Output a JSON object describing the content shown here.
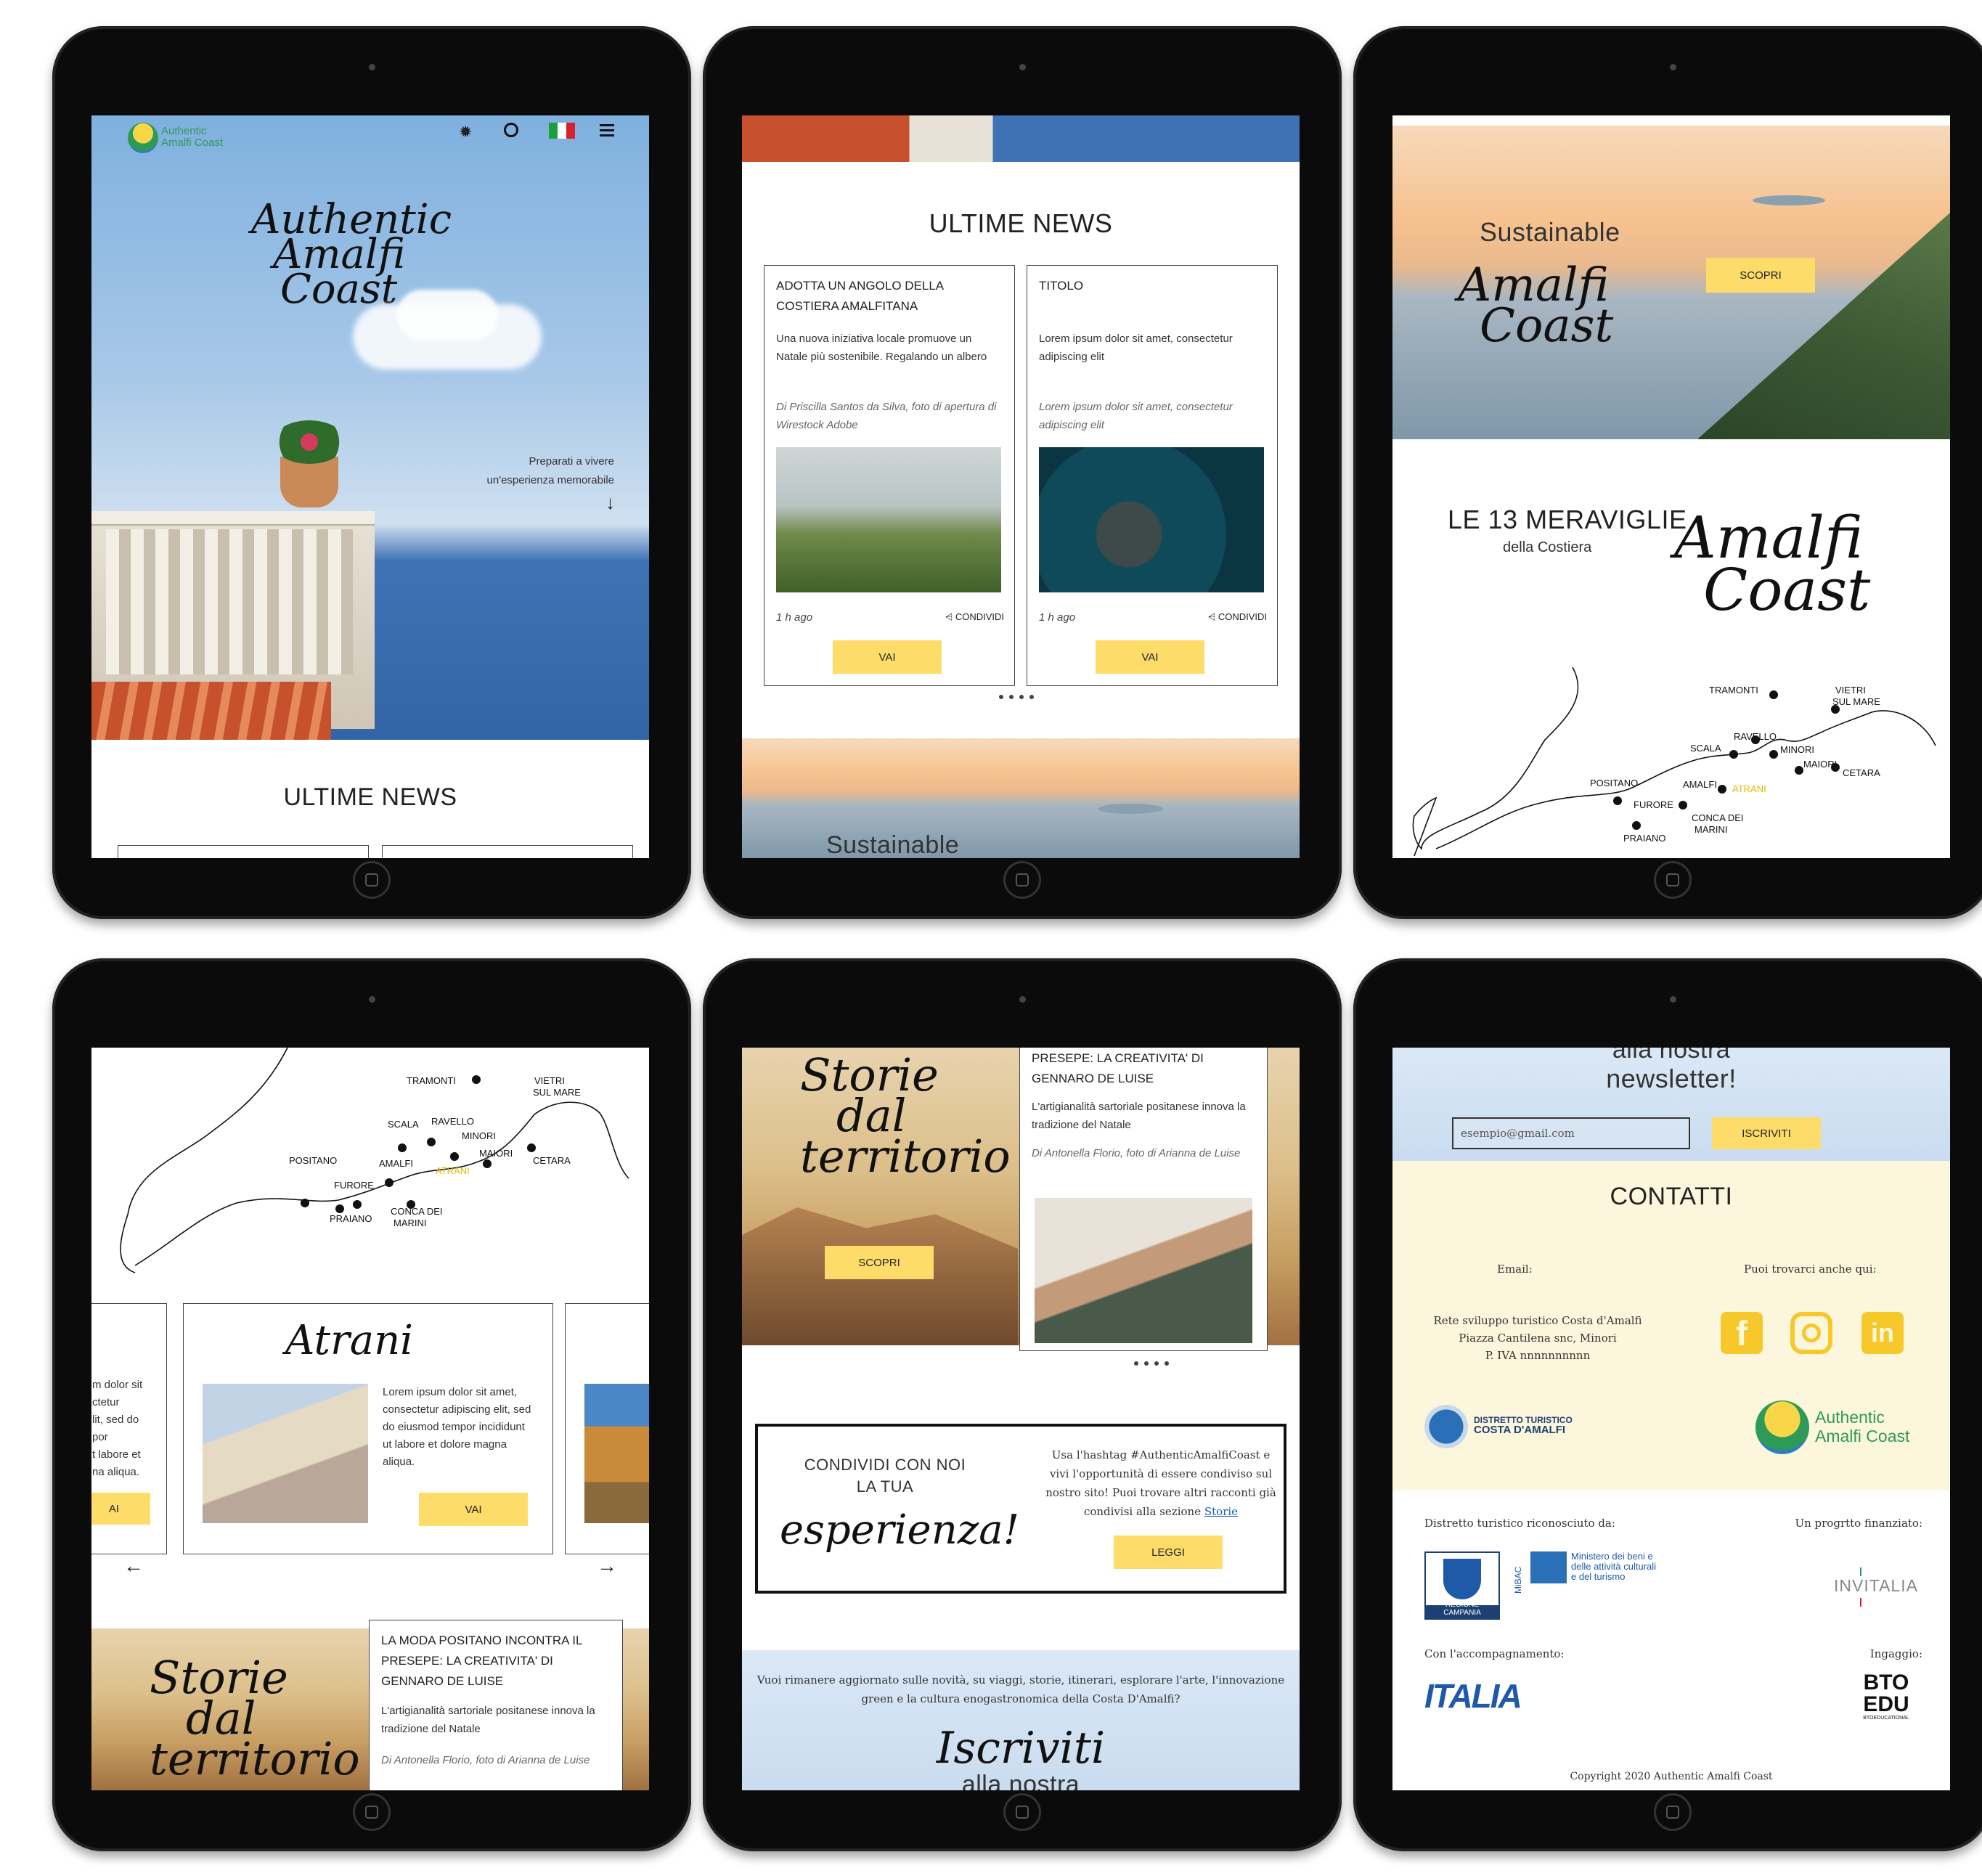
{
  "colors": {
    "accent": "#fddc6a",
    "frame": "#0b0b0b",
    "link": "#1a56c9",
    "yellow_label": "#e6b800"
  },
  "t1": {
    "logo_line1": "Authentic",
    "logo_line2": "Amalfi Coast",
    "icons": [
      "settings-icon",
      "search-icon",
      "italy-flag-icon",
      "menu-icon"
    ],
    "hero_script": [
      "Authentic",
      "Amalfi",
      "Coast"
    ],
    "hero_tagline_1": "Preparati a vivere",
    "hero_tagline_2": "un'esperienza memorabile",
    "arrow": "↓",
    "news_heading": "ULTIME NEWS"
  },
  "t2": {
    "news_heading": "ULTIME NEWS",
    "cards": [
      {
        "title": "ADOTTA UN ANGOLO DELLA COSTIERA AMALFITANA",
        "body": "Una nuova iniziativa locale promuove un Natale più sostenibile. Regalando un albero",
        "author": "Di Priscilla Santos da Silva, foto di apertura di Wirestock Adobe",
        "time": "1 h ago",
        "share": "CONDIVIDI",
        "button": "VAI"
      },
      {
        "title": "TITOLO",
        "body": "Lorem ipsum dolor sit amet, consectetur adipiscing elit",
        "author": "Lorem ipsum dolor sit amet, consectetur adipiscing elit",
        "time": "1 h ago",
        "share": "CONDIVIDI",
        "button": "VAI"
      }
    ],
    "bottom_peek": "Sustainable"
  },
  "t3": {
    "sustainable": "Sustainable",
    "script": [
      "Amalfi",
      "Coast"
    ],
    "button": "SCOPRI",
    "wonders_title": "LE 13 MERAVIGLIE",
    "wonders_sub": "della Costiera",
    "map_script": [
      "Amalfi",
      "Coast"
    ],
    "places": [
      "TRAMONTI",
      "VIETRI",
      "SUL MARE",
      "SCALA",
      "RAVELLO",
      "MINORI",
      "MAIORI",
      "CETARA",
      "POSITANO",
      "AMALFI",
      "ATRANI",
      "FURORE",
      "PRAIANO",
      "CONCA DEI",
      "MARINI"
    ]
  },
  "t4": {
    "places": [
      "TRAMONTI",
      "VIETRI",
      "SUL MARE",
      "SCALA",
      "RAVELLO",
      "MINORI",
      "MAIORI",
      "CETARA",
      "POSITANO",
      "AMALFI",
      "ATRANI",
      "FURORE",
      "PRAIANO",
      "CONCA DEI",
      "MARINI"
    ],
    "left_card_text": "m dolor sit\nctetur\nlit, sed do\npor\nt labore et\nna aliqua.",
    "left_card_button": "AI",
    "atrani_title": "Atrani",
    "atrani_text": "Lorem ipsum dolor sit amet, consectetur adipiscing elit, sed do eiusmod tempor incididunt ut labore et dolore magna aliqua.",
    "atrani_button": "VAI",
    "prev_arrow": "←",
    "next_arrow": "→",
    "storie_script": [
      "Storie",
      "dal",
      "territorio"
    ],
    "story_title": "LA MODA POSITANO INCONTRA IL PRESEPE: LA CREATIVITA' DI GENNARO DE LUISE",
    "story_body": "L'artigianalità sartoriale positanese innova la tradizione del Natale",
    "story_author": "Di Antonella Florio, foto di Arianna de Luise"
  },
  "t5": {
    "storie_script": [
      "Storie",
      "dal",
      "territorio"
    ],
    "storie_button": "SCOPRI",
    "story_title": "PRESEPE: LA CREATIVITA' DI GENNARO DE LUISE",
    "story_body": "L'artigianalità sartoriale positanese innova la tradizione del Natale",
    "story_author": "Di Antonella Florio, foto di Arianna de Luise",
    "share_line1": "CONDIVIDI CON NOI",
    "share_line2": "LA TUA",
    "share_script": "esperienza!",
    "share_text": "Usa l'hashtag #AuthenticAmalfiCoast e vivi l'opportunità di essere condiviso sul nostro sito! Puoi trovare altri racconti già condivisi alla sezione",
    "share_link": "Storie",
    "share_button": "LEGGI",
    "newsletter_text": "Vuoi rimanere aggiornato sulle novità, su viaggi, storie, itinerari, esplorare l'arte, l'innovazione green e la cultura enogastronomica della Costa D'Amalfi?",
    "iscriviti": "Iscriviti",
    "alla_nostra": "alla nostra"
  },
  "t6": {
    "alla_nostra": "alla nostra",
    "newsletter": "newsletter!",
    "email_placeholder": "esempio@gmail.com",
    "subscribe_button": "ISCRIVITI",
    "contacts_heading": "CONTATTI",
    "email_label": "Email:",
    "find_us": "Puoi trovarci anche qui:",
    "address_1": "Rete sviluppo turistico Costa d'Amalfi",
    "address_2": "Piazza Cantilena snc, Minori",
    "address_3": "P. IVA nnnnnnnnnn",
    "social_icons": [
      "facebook-icon",
      "instagram-icon",
      "linkedin-icon"
    ],
    "distretto_1": "DISTRETTO TURISTICO",
    "distretto_2": "COSTA D'AMALFI",
    "logo_line1": "Authentic",
    "logo_line2": "Amalfi Coast",
    "recognized": "Distretto turistico riconosciuto da:",
    "funded": "Un progrtto finanziato:",
    "regione": "REGIONE CAMPANIA",
    "mibac_short": "MiBAC",
    "mibac": "Ministero dei beni e delle attività culturali e del turismo",
    "invitalia": "INVITALIA",
    "accompaniment": "Con l'accompagnamento:",
    "italia": "ITALIA",
    "ingaggio": "Ingaggio:",
    "bto_1": "BTO",
    "bto_2": "EDU",
    "bto_3": "BTOEDUCATIONAL",
    "copyright": "Copyright 2020 Authentic Amalfi Coast"
  }
}
